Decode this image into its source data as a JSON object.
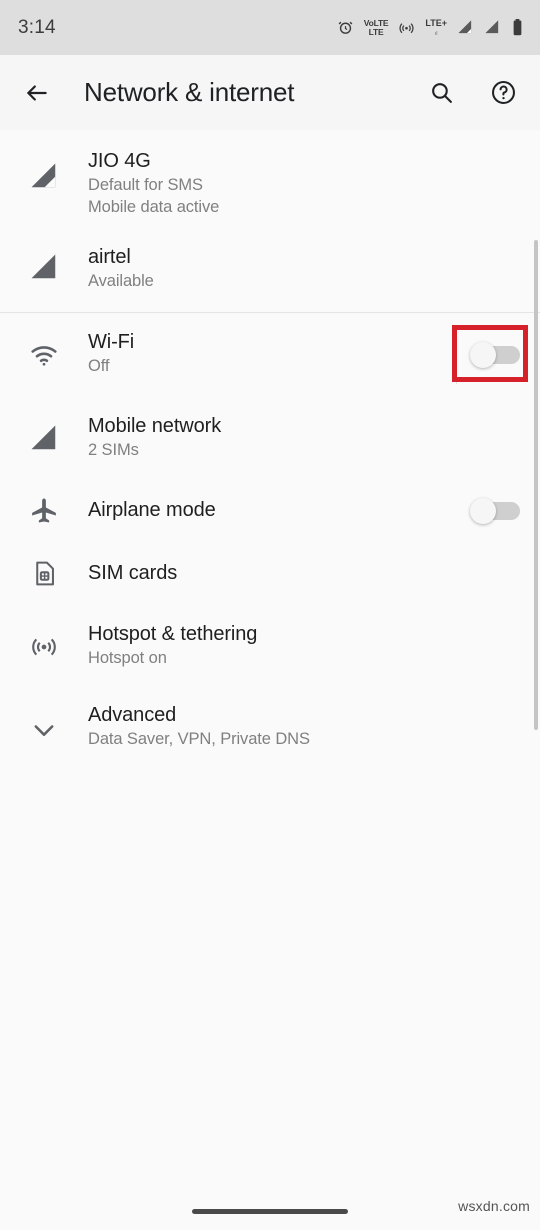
{
  "status_bar": {
    "time": "3:14",
    "icons": [
      {
        "name": "alarm-icon",
        "label": "alarm"
      },
      {
        "name": "volte-icon",
        "label": "VoLTE",
        "line1": "VoLTE",
        "line2": "LTE"
      },
      {
        "name": "hotspot-icon",
        "label": "hotspot"
      },
      {
        "name": "lte-plus-icon",
        "label": "LTE+",
        "line1": "LTE+"
      },
      {
        "name": "signal-bars-sim1-icon",
        "label": "signal sim 1"
      },
      {
        "name": "signal-bars-sim2-icon",
        "label": "signal sim 2"
      },
      {
        "name": "battery-icon",
        "label": "battery"
      }
    ]
  },
  "app_bar": {
    "back_label": "Back",
    "title": "Network & internet",
    "search_label": "Search",
    "help_label": "Help"
  },
  "sim_section": [
    {
      "icon": "signal-bars-outline-icon",
      "title": "JIO 4G",
      "sub1": "Default for SMS",
      "sub2": "Mobile data active"
    },
    {
      "icon": "signal-bars-filled-icon",
      "title": "airtel",
      "sub1": "Available",
      "sub2": ""
    }
  ],
  "settings_items": [
    {
      "icon": "wifi-icon",
      "title": "Wi-Fi",
      "sub": "Off",
      "toggle": "off",
      "highlighted": "true"
    },
    {
      "icon": "signal-bars-filled-icon",
      "title": "Mobile network",
      "sub": "2 SIMs",
      "toggle": "",
      "highlighted": "false"
    },
    {
      "icon": "airplane-icon",
      "title": "Airplane mode",
      "sub": "",
      "toggle": "off",
      "highlighted": "false"
    },
    {
      "icon": "sim-card-icon",
      "title": "SIM cards",
      "sub": "",
      "toggle": "",
      "highlighted": "false"
    },
    {
      "icon": "hotspot-icon",
      "title": "Hotspot & tethering",
      "sub": "Hotspot on",
      "toggle": "",
      "highlighted": "false"
    },
    {
      "icon": "chevron-down-icon",
      "title": "Advanced",
      "sub": "Data Saver, VPN, Private DNS",
      "toggle": "",
      "highlighted": "false"
    }
  ],
  "annotation": {
    "color": "#d6202a",
    "target": "wifi-toggle"
  },
  "watermark": {
    "text": "wsxdn.com"
  },
  "colors": {
    "status_bar_bg": "#dedede",
    "app_bar_bg": "#f6f6f6",
    "page_bg": "#fafafa",
    "title_text": "#1f1f1f",
    "sub_text": "#808080",
    "icon": "#5f6368",
    "divider": "#e4e4e4",
    "toggle_track_off": "#cfcfcf",
    "toggle_knob_off": "#f6f6f6"
  }
}
